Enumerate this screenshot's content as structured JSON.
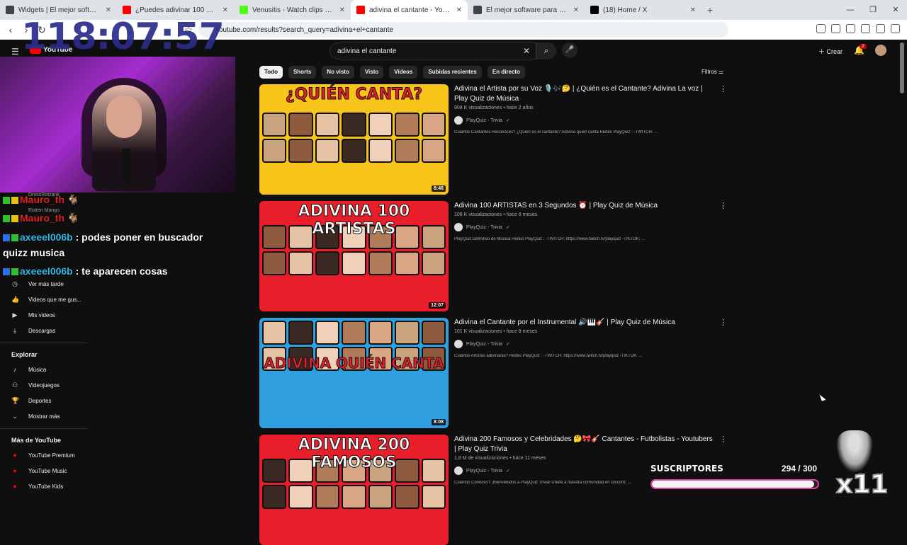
{
  "browser": {
    "tabs": [
      {
        "label": "Widgets | El mejor software para pot",
        "color": "#444"
      },
      {
        "label": "¿Puedes adivinar 100 PERSONAJES c",
        "color": "#ff0000"
      },
      {
        "label": "Venusitis - Watch clips on Kick",
        "color": "#53fc18"
      },
      {
        "label": "adivina el cantante - YouTube",
        "color": "#ff0000",
        "active": true
      },
      {
        "label": "El mejor software para potenciar tu s",
        "color": "#444"
      },
      {
        "label": "(18) Home / X",
        "color": "#000"
      }
    ],
    "url": "youtube.com/results?search_query=adivina+el+cantante"
  },
  "stream": {
    "timer": "118:07:57",
    "chat": [
      {
        "user": "Mauro_th",
        "text": ""
      },
      {
        "user": "Mauro_th",
        "text": ""
      },
      {
        "user": "axeeel006b",
        "text": ": podes poner en buscador"
      },
      {
        "user": "",
        "text": "quizz musica"
      },
      {
        "user": "axeeel006b",
        "text": ": te aparecen cosas"
      }
    ],
    "faint_texts": [
      "DrossRotzank",
      "Rotten Mango"
    ],
    "subs_label": "SUSCRIPTORES",
    "subs_count": "294",
    "subs_goal": "300",
    "subs_fraction": 0.98,
    "multiplier": "x11"
  },
  "youtube": {
    "logo": "YouTube",
    "search_value": "adivina el cantante",
    "create_label": "Crear",
    "notif_count": "2",
    "chips": [
      "Todo",
      "Shorts",
      "No visto",
      "Visto",
      "Videos",
      "Subidas recientes",
      "En directo"
    ],
    "filters_label": "Filtros",
    "sidebar": {
      "items": [
        {
          "icon": "clock-icon",
          "glyph": "◷",
          "label": "Ver más tarde"
        },
        {
          "icon": "thumb-up-icon",
          "glyph": "👍",
          "label": "Videos que me gus..."
        },
        {
          "icon": "play-box-icon",
          "glyph": "▶",
          "label": "Mis videos"
        },
        {
          "icon": "download-icon",
          "glyph": "⤓",
          "label": "Descargas"
        }
      ],
      "explore_title": "Explorar",
      "explore": [
        {
          "icon": "music-note-icon",
          "glyph": "♪",
          "label": "Música"
        },
        {
          "icon": "gamepad-icon",
          "glyph": "⚇",
          "label": "Videojuegos"
        },
        {
          "icon": "trophy-icon",
          "glyph": "🏆",
          "label": "Deportes"
        },
        {
          "icon": "chevron-down-icon",
          "glyph": "⌄",
          "label": "Mostrar más"
        }
      ],
      "more_title": "Más de YouTube",
      "more": [
        {
          "icon": "yt-premium-icon",
          "label": "YouTube Premium"
        },
        {
          "icon": "yt-music-icon",
          "label": "YouTube Music"
        },
        {
          "icon": "yt-kids-icon",
          "label": "YouTube Kids"
        }
      ]
    },
    "results": [
      {
        "title": "Adivina el Artista por su Voz 🎙️🎶🤔 | ¿Quién es el Cantante? Adivina La voz | Play Quiz de Música",
        "meta": "908 K visualizaciones • hace 2 años",
        "channel": "PlayQuiz - Trivia",
        "desc": "Cuántos Cantantes Reconoces? ¿Quién es el cantante? Adivina quien canta Redes PlayQuiz : -TWITCH: ...",
        "duration": "8:46",
        "thumb_text": "¿QUIÉN CANTA?",
        "thumb_bg": "#f7c41a",
        "thumb_fg": "#e81f2a"
      },
      {
        "title": "Adivina 100 ARTISTAS en 3 Segundos ⏰ | Play Quiz de Música",
        "meta": "108 K visualizaciones • hace 6 meses",
        "channel": "PlayQuiz - Trivia",
        "desc": "PlayQuiz Definitivo de Música Redes PlayQuiz : -TWITCH: https://www.twitch.tv/playquiz -TIKTOK: ...",
        "duration": "12:07",
        "thumb_text": "ADIVINA 100 ARTISTAS",
        "thumb_bg": "#e81f2a",
        "thumb_fg": "#ffffff"
      },
      {
        "title": "Adivina el Cantante por el Instrumental 🔊🎹🎸 | Play Quiz de Música",
        "meta": "101 K visualizaciones • hace 8 meses",
        "channel": "PlayQuiz - Trivia",
        "desc": "Cuántos Artistas adivinarás? Redes PlayQuiz : -TWITCH: https://www.twitch.tv/playquiz -TIKTOK: ...",
        "duration": "8:08",
        "thumb_text": "ADIVINA QUIÉN CANTA",
        "thumb_bg": "#2f9fe0",
        "thumb_fg": "#e81f2a"
      },
      {
        "title": "Adivina 200 Famosos y Celebridades 🤔🎀🎸 Cantantes - Futbolistas - Youtubers | Play Quiz Trivia",
        "meta": "1,8 M de visualizaciones • hace 11 meses",
        "channel": "PlayQuiz - Trivia",
        "desc": "Cuántos Conoces? ¡Bienvenidos a PlayQuiz Trivia! Únete a nuestra comunidad en Discord: ...",
        "duration": "",
        "thumb_text": "ADIVINA 200 FAMOSOS",
        "thumb_bg": "#e81f2a",
        "thumb_fg": "#ffffff"
      }
    ]
  }
}
